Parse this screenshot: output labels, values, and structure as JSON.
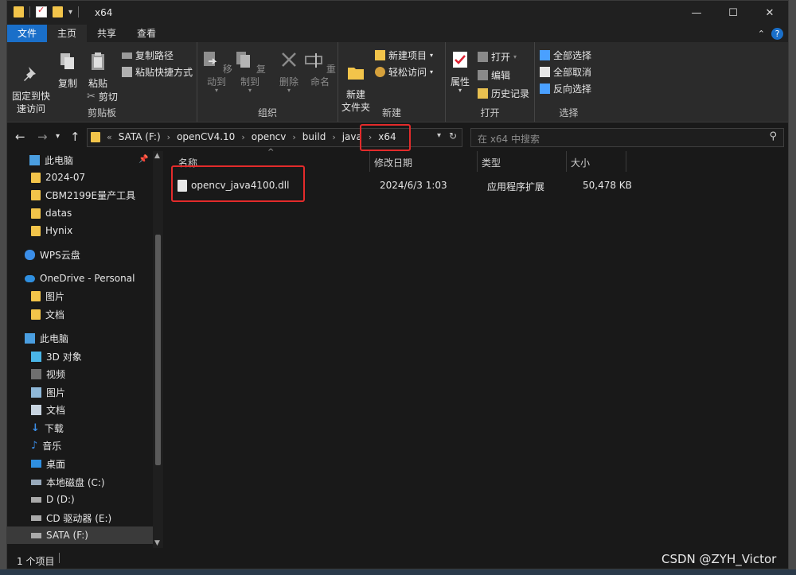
{
  "window": {
    "title": "x64"
  },
  "window_buttons": {
    "minimize": "—",
    "maximize": "☐",
    "close": "✕"
  },
  "tabs": [
    {
      "label": "文件"
    },
    {
      "label": "主页"
    },
    {
      "label": "共享"
    },
    {
      "label": "查看"
    }
  ],
  "help_label": "?",
  "ribbon": {
    "clipboard": {
      "label": "剪贴板",
      "pin": "固定到快\n速访问",
      "copy": "复制",
      "paste": "粘贴",
      "copy_path": "复制路径",
      "paste_shortcut": "粘贴快捷方式",
      "cut": "剪切"
    },
    "organize": {
      "label": "组织",
      "move_to": "移动到",
      "copy_to": "复制到",
      "delete": "删除",
      "rename": "重命名"
    },
    "new": {
      "label": "新建",
      "new_folder": "新建\n文件夹",
      "new_item": "新建项目",
      "easy_access": "轻松访问"
    },
    "open": {
      "label": "打开",
      "properties": "属性",
      "open": "打开",
      "edit": "编辑",
      "history": "历史记录"
    },
    "select": {
      "label": "选择",
      "select_all": "全部选择",
      "select_none": "全部取消",
      "invert": "反向选择"
    }
  },
  "address": {
    "crumbs": [
      "SATA (F:)",
      "openCV4.10",
      "opencv",
      "build",
      "java",
      "x64"
    ],
    "search_placeholder": "在 x64 中搜索"
  },
  "sidebar": {
    "items": [
      {
        "label": "此电脑",
        "icon": "monitor-icon"
      },
      {
        "label": "2024-07",
        "icon": "folder-icon"
      },
      {
        "label": "CBM2199E量产工具",
        "icon": "folder-icon"
      },
      {
        "label": "datas",
        "icon": "folder-icon"
      },
      {
        "label": "Hynix",
        "icon": "folder-icon"
      },
      {
        "label": "WPS云盘",
        "icon": "cloud-icon"
      },
      {
        "label": "OneDrive - Personal",
        "icon": "onedrive-icon"
      },
      {
        "label": "图片",
        "icon": "folder-icon"
      },
      {
        "label": "文档",
        "icon": "folder-icon"
      },
      {
        "label": "此电脑",
        "icon": "monitor-icon"
      },
      {
        "label": "3D 对象",
        "icon": "cube-icon"
      },
      {
        "label": "视频",
        "icon": "video-icon"
      },
      {
        "label": "图片",
        "icon": "picture-icon"
      },
      {
        "label": "文档",
        "icon": "document-icon"
      },
      {
        "label": "下载",
        "icon": "download-icon"
      },
      {
        "label": "音乐",
        "icon": "music-icon"
      },
      {
        "label": "桌面",
        "icon": "desktop-icon"
      },
      {
        "label": "本地磁盘 (C:)",
        "icon": "drive-icon"
      },
      {
        "label": "D (D:)",
        "icon": "drive-icon"
      },
      {
        "label": "CD 驱动器 (E:)",
        "icon": "cd-drive-icon"
      },
      {
        "label": "SATA (F:)",
        "icon": "drive-icon"
      }
    ]
  },
  "columns": [
    "名称",
    "修改日期",
    "类型",
    "大小"
  ],
  "files": [
    {
      "name": "opencv_java4100.dll",
      "modified": "2024/6/3 1:03",
      "type": "应用程序扩展",
      "size": "50,478 KB"
    }
  ],
  "status": {
    "count": "1 个项目"
  },
  "watermark": "CSDN @ZYH_Victor",
  "colors": {
    "accent": "#1a6fc9",
    "highlight_box": "#e32b2b",
    "folder": "#f2c44a"
  }
}
